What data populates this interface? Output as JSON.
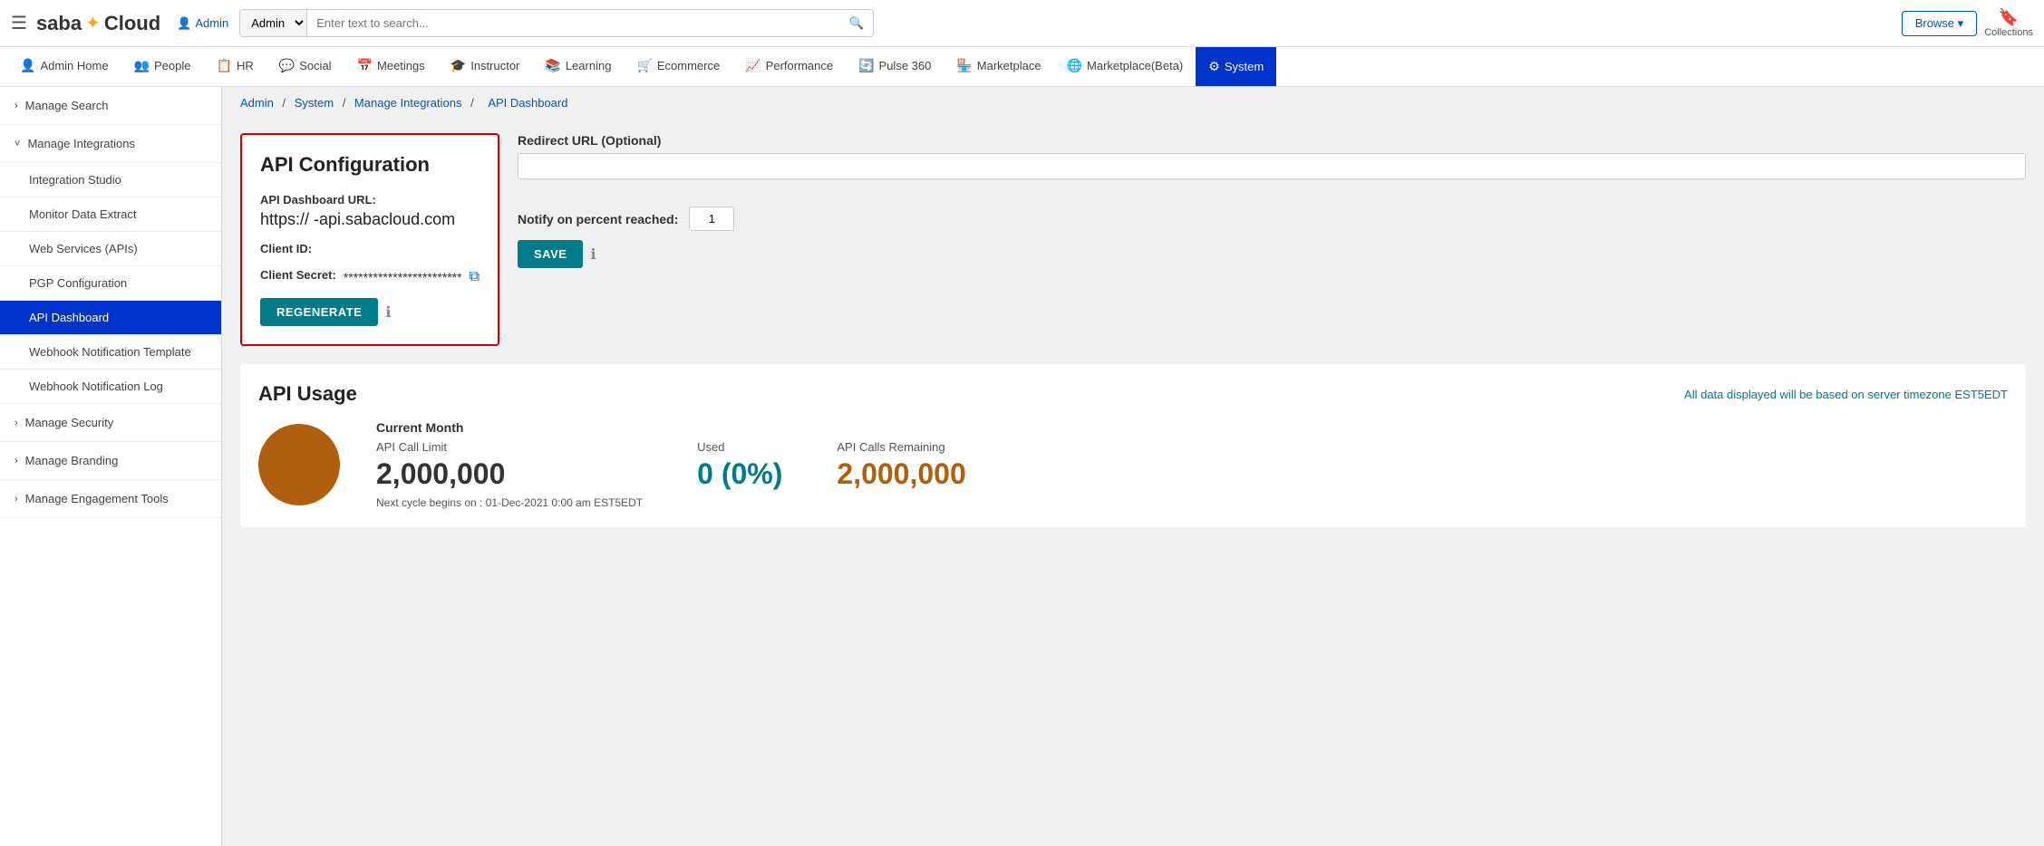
{
  "topbar": {
    "hamburger": "☰",
    "logo": "Saba",
    "logo_star": "✦",
    "logo_cloud": "Cloud",
    "admin_label": "Admin",
    "search_dropdown": "Admin",
    "search_placeholder": "Enter text to search...",
    "browse_label": "Browse ▾",
    "collections_label": "Collections"
  },
  "nav": {
    "items": [
      {
        "id": "admin-home",
        "icon": "👤",
        "label": "Admin Home"
      },
      {
        "id": "people",
        "icon": "👥",
        "label": "People"
      },
      {
        "id": "hr",
        "icon": "📋",
        "label": "HR"
      },
      {
        "id": "social",
        "icon": "💬",
        "label": "Social"
      },
      {
        "id": "meetings",
        "icon": "📅",
        "label": "Meetings"
      },
      {
        "id": "instructor",
        "icon": "🎓",
        "label": "Instructor"
      },
      {
        "id": "learning",
        "icon": "📚",
        "label": "Learning"
      },
      {
        "id": "ecommerce",
        "icon": "🛒",
        "label": "Ecommerce"
      },
      {
        "id": "performance",
        "icon": "📈",
        "label": "Performance"
      },
      {
        "id": "pulse360",
        "icon": "🔄",
        "label": "Pulse 360"
      },
      {
        "id": "marketplace",
        "icon": "🏪",
        "label": "Marketplace"
      },
      {
        "id": "marketplace-beta",
        "icon": "🌐",
        "label": "Marketplace(Beta)"
      },
      {
        "id": "system",
        "icon": "⚙",
        "label": "System",
        "active": true
      }
    ]
  },
  "sidebar": {
    "items": [
      {
        "id": "manage-search",
        "label": "Manage Search",
        "type": "collapsed",
        "chevron": "›"
      },
      {
        "id": "manage-integrations",
        "label": "Manage Integrations",
        "type": "expanded",
        "chevron": "˅"
      },
      {
        "id": "integration-studio",
        "label": "Integration Studio",
        "type": "sub"
      },
      {
        "id": "monitor-data-extract",
        "label": "Monitor Data Extract",
        "type": "sub"
      },
      {
        "id": "web-services-apis",
        "label": "Web Services (APIs)",
        "type": "sub"
      },
      {
        "id": "pgp-configuration",
        "label": "PGP Configuration",
        "type": "sub"
      },
      {
        "id": "api-dashboard",
        "label": "API Dashboard",
        "type": "sub",
        "active": true
      },
      {
        "id": "webhook-notification-template",
        "label": "Webhook Notification Template",
        "type": "sub"
      },
      {
        "id": "webhook-notification-log",
        "label": "Webhook Notification Log",
        "type": "sub"
      },
      {
        "id": "manage-security",
        "label": "Manage Security",
        "type": "collapsed",
        "chevron": "›"
      },
      {
        "id": "manage-branding",
        "label": "Manage Branding",
        "type": "collapsed",
        "chevron": "›"
      },
      {
        "id": "manage-engagement-tools",
        "label": "Manage Engagement Tools",
        "type": "collapsed",
        "chevron": "›"
      }
    ]
  },
  "breadcrumb": {
    "parts": [
      "Admin",
      "System",
      "Manage Integrations",
      "API Dashboard"
    ],
    "links": [
      true,
      true,
      true,
      false
    ]
  },
  "api_config": {
    "title": "API Configuration",
    "url_label": "API Dashboard URL:",
    "url_value": "https://          -api.sabacloud.com",
    "client_id_label": "Client ID:",
    "client_id_value": "",
    "client_secret_label": "Client Secret:",
    "client_secret_value": "************************",
    "regenerate_label": "REGENERATE"
  },
  "right_panel": {
    "redirect_label": "Redirect URL (Optional)",
    "redirect_value": "",
    "redirect_placeholder": "",
    "notify_label": "Notify on percent reached:",
    "notify_value": "1",
    "save_label": "SAVE"
  },
  "api_usage": {
    "title": "API Usage",
    "timezone_note": "All data displayed will be based on server timezone EST5EDT",
    "current_month_label": "Current Month",
    "call_limit_label": "API Call Limit",
    "call_limit_value": "2,000,000",
    "used_label": "Used",
    "used_value": "0 (0%)",
    "remaining_label": "API Calls Remaining",
    "remaining_value": "2,000,000",
    "next_cycle_label": "Next cycle begins on : 01-Dec-2021 0:00 am EST5EDT"
  },
  "colors": {
    "active_nav": "#0033cc",
    "active_sidebar": "#0033cc",
    "teal": "#007b8a",
    "orange": "#b05f0e",
    "border_red": "#cc0000",
    "link_blue": "#0057b8"
  }
}
